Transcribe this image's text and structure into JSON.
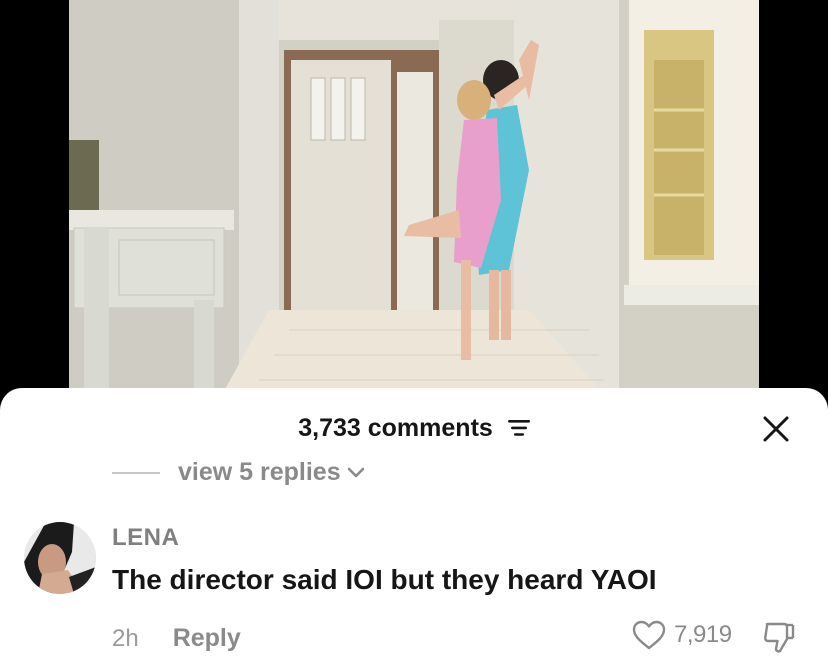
{
  "sheet": {
    "comment_count": "3,733 comments",
    "filter_icon": "filter-icon",
    "close_icon": "close-icon"
  },
  "replies_toggle": {
    "label": "view 5 replies",
    "icon": "chevron-down-icon"
  },
  "comment": {
    "username": "LENA",
    "text": "The director said IOI but they heard YAOI",
    "time": "2h",
    "reply_label": "Reply",
    "like_count": "7,919",
    "like_icon": "heart-icon",
    "dislike_icon": "thumbs-down-icon"
  },
  "colors": {
    "sheet_bg": "#ffffff",
    "text_primary": "#161616",
    "text_secondary": "#8a8a8a"
  }
}
